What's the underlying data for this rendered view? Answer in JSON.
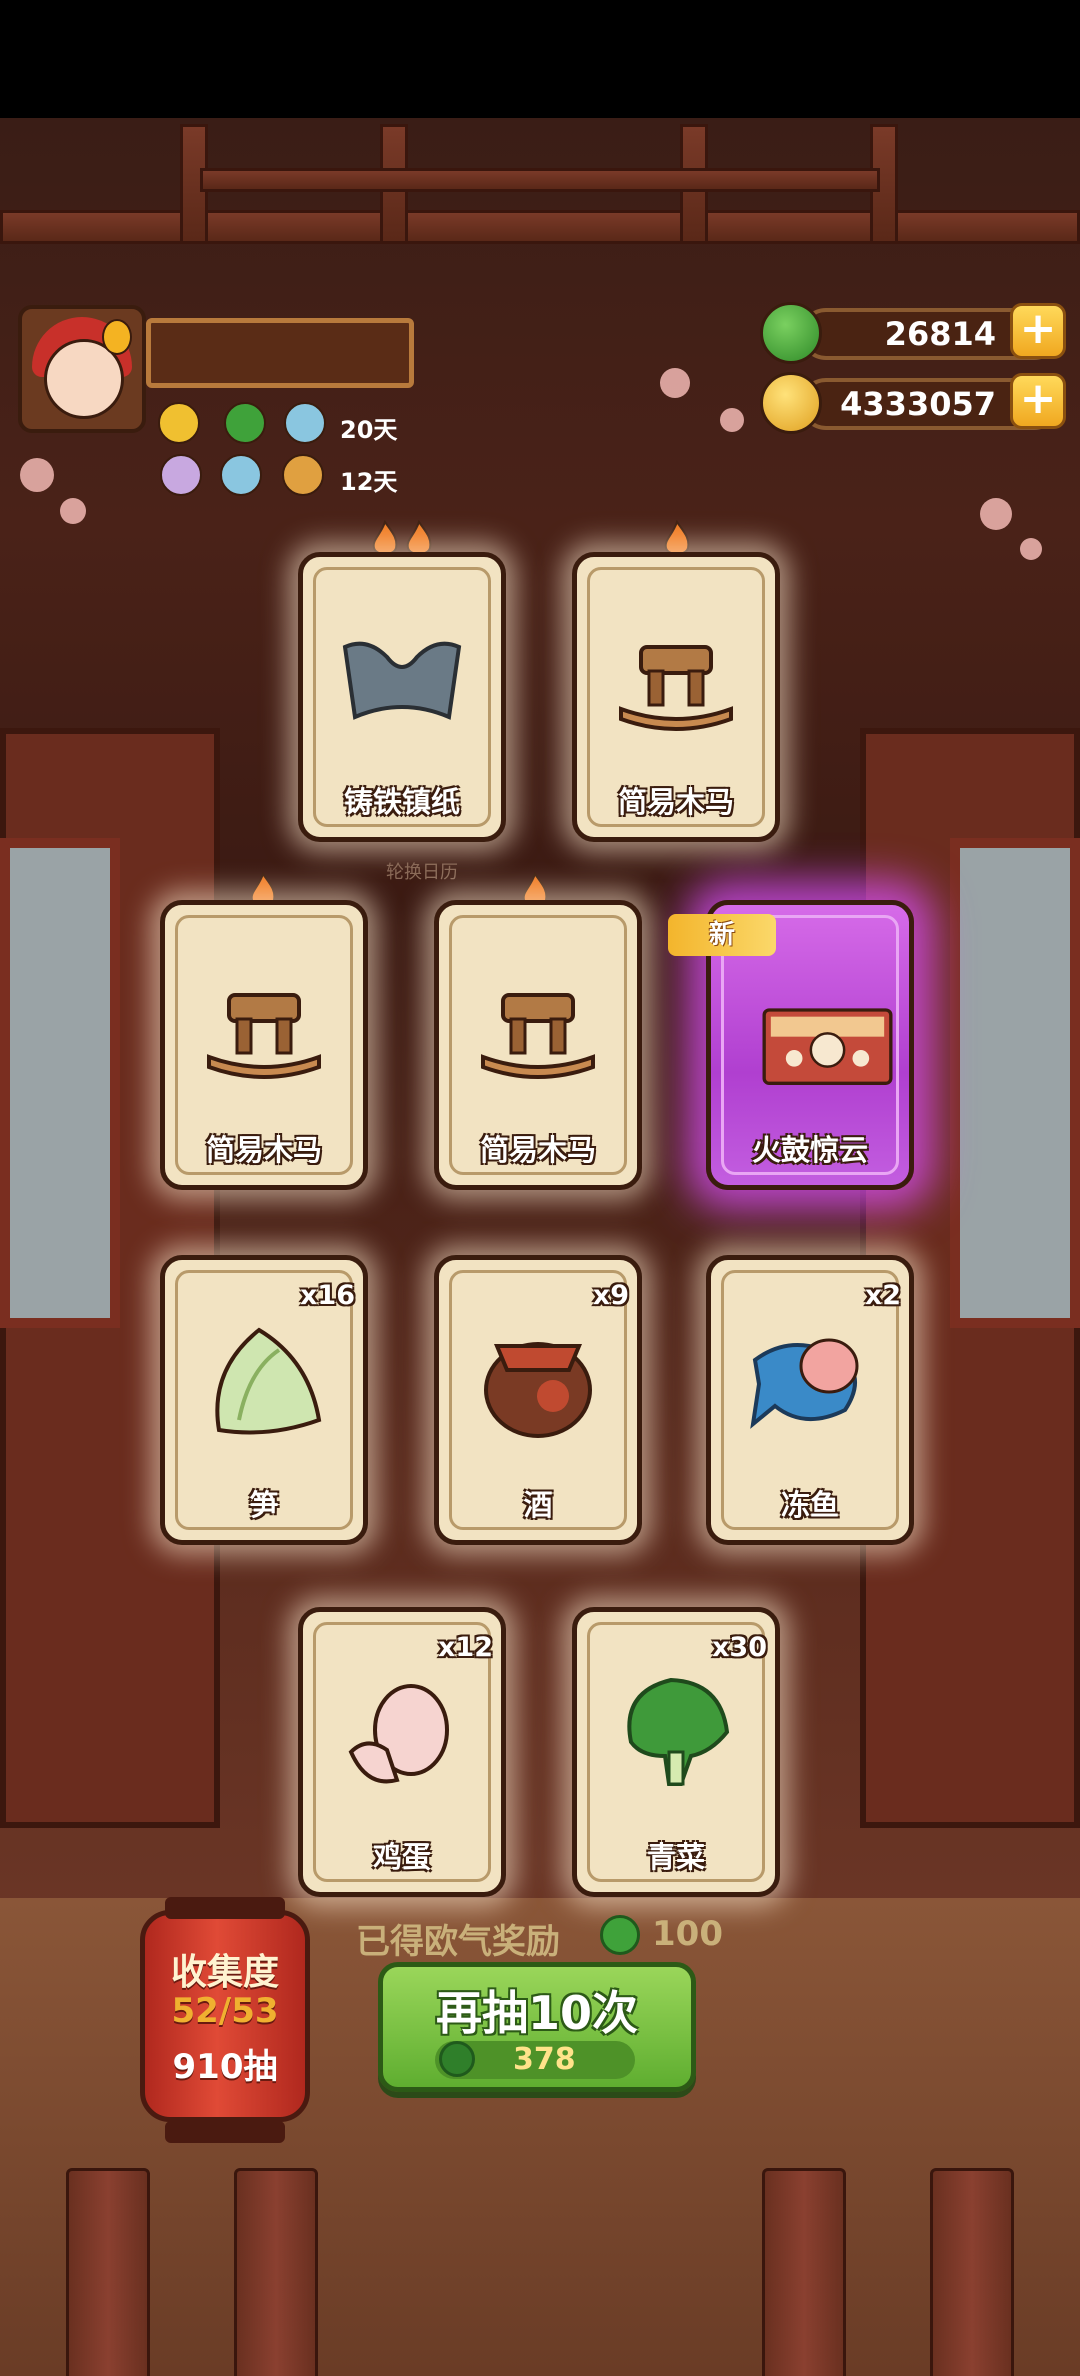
{
  "hud": {
    "jade_amount": "26814",
    "coin_amount": "4333057",
    "buff_row1_days": "20天",
    "buff_row2_days": "12天"
  },
  "calendar_caption": "轮换日历",
  "new_badge": "新",
  "cards": [
    {
      "name": "铸铁镇纸",
      "qty": "",
      "art": "iron-paperweight-icon"
    },
    {
      "name": "简易木马",
      "qty": "",
      "art": "wooden-horse-icon"
    },
    {
      "name": "简易木马",
      "qty": "",
      "art": "wooden-horse-icon"
    },
    {
      "name": "简易木马",
      "qty": "",
      "art": "wooden-horse-icon"
    },
    {
      "name": "火鼓惊云",
      "qty": "",
      "art": "fire-drum-stage-icon"
    },
    {
      "name": "笋",
      "qty": "x16",
      "art": "bamboo-shoot-icon"
    },
    {
      "name": "酒",
      "qty": "x9",
      "art": "wine-jar-icon"
    },
    {
      "name": "冻鱼",
      "qty": "x2",
      "art": "frozen-fish-icon"
    },
    {
      "name": "鸡蛋",
      "qty": "x12",
      "art": "egg-icon"
    },
    {
      "name": "青菜",
      "qty": "x30",
      "art": "greens-icon"
    }
  ],
  "reward": {
    "label": "已得欧气奖励",
    "value": "100"
  },
  "draw_button": {
    "label": "再抽10次",
    "cost": "378"
  },
  "collection": {
    "title": "收集度",
    "progress": "52/53",
    "draws": "910抽"
  },
  "colors": {
    "green_button": "#5fae30",
    "card_bg": "#f2e3c2",
    "special_glow": "#c35ee0",
    "coin_gold": "#f0a820"
  }
}
